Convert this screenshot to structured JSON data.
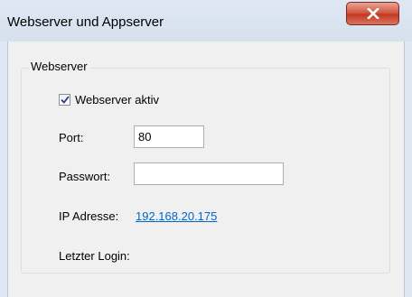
{
  "window": {
    "title": "Webserver und Appserver",
    "close_symbol": "X"
  },
  "webserver": {
    "group_label": "Webserver",
    "active_label": "Webserver aktiv",
    "active_checked": true,
    "port_label": "Port:",
    "port_value": "80",
    "password_label": "Passwort:",
    "password_value": "",
    "ip_label": "IP Adresse:",
    "ip_value": "192.168.20.175",
    "last_login_label": "Letzter Login:"
  }
}
